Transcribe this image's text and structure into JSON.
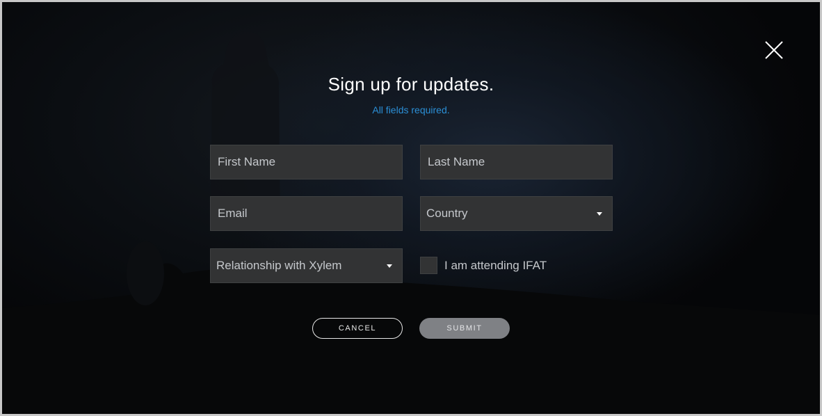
{
  "modal": {
    "title": "Sign up for updates.",
    "subtitle": "All fields required.",
    "close_icon": "close-icon"
  },
  "form": {
    "first_name": {
      "placeholder": "First Name",
      "value": ""
    },
    "last_name": {
      "placeholder": "Last Name",
      "value": ""
    },
    "email": {
      "placeholder": "Email",
      "value": ""
    },
    "country": {
      "selected": "Country"
    },
    "relationship": {
      "selected": "Relationship with Xylem"
    },
    "ifat_checkbox": {
      "label": "I am attending IFAT",
      "checked": false
    }
  },
  "buttons": {
    "cancel": "CANCEL",
    "submit": "SUBMIT"
  },
  "colors": {
    "accent": "#2b8fd6",
    "field_bg": "#323334",
    "submit_bg": "#7f8185"
  }
}
